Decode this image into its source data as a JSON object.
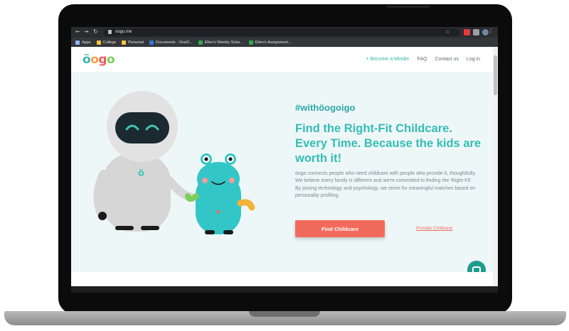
{
  "browser": {
    "url": "oogo.me",
    "bookmarks": [
      {
        "label": "Apps",
        "color": "#8ab4f8"
      },
      {
        "label": "College",
        "color": "#f4c542"
      },
      {
        "label": "Personal",
        "color": "#f4c542"
      },
      {
        "label": "Documents - OneD...",
        "color": "#2f7de1"
      },
      {
        "label": "Ellen's Weekly Sche...",
        "color": "#34a853"
      },
      {
        "label": "Ellen's Assignment...",
        "color": "#34a853"
      }
    ]
  },
  "site": {
    "logo": "öogo",
    "nav": {
      "become_minder": "+ Become a Minder",
      "faq": "FAQ",
      "contact": "Contact us",
      "login": "Log in"
    },
    "hero": {
      "hashtag": "#withöogoigo",
      "headline": "Find the Right-Fit Childcare. Every Time. Because the kids are worth it!",
      "description": "öogo connects people who need childcare with people who provide it, thoughtfully. We believe every family is different and we're committed to finding the 'Right-Fit'. By joining technology and psychology, we strive for meaningful matches based on personality profiling.",
      "primary_cta": "Find Childcare",
      "secondary_cta": "Provide Childcare"
    },
    "colors": {
      "teal": "#35bdb6",
      "coral": "#f26a5c",
      "hero_bg": "#eef7f8"
    }
  },
  "icons": [
    "back-arrow-icon",
    "forward-arrow-icon",
    "reload-icon",
    "lock-icon",
    "star-icon",
    "chat-icon"
  ]
}
